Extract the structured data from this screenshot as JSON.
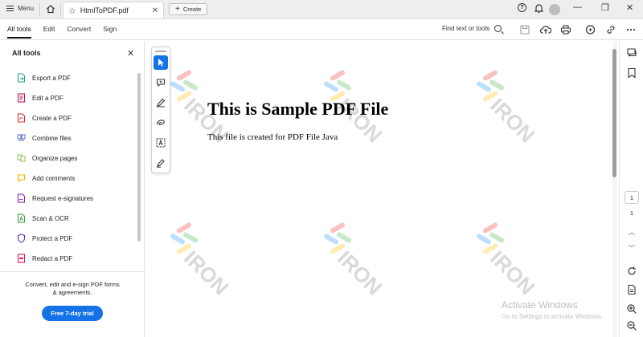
{
  "titlebar": {
    "menu_label": "Menu",
    "tab_title": "HtmlToPDF.pdf",
    "create_label": "Create"
  },
  "toolbar": {
    "tabs": [
      "All tools",
      "Edit",
      "Convert",
      "Sign"
    ],
    "find_label": "Find text or tools"
  },
  "left_panel": {
    "title": "All tools",
    "items": [
      {
        "label": "Export a PDF",
        "icon": "export-pdf-icon",
        "color": "#2f9e8f"
      },
      {
        "label": "Edit a PDF",
        "icon": "edit-pdf-icon",
        "color": "#c2185b"
      },
      {
        "label": "Create a PDF",
        "icon": "create-pdf-icon",
        "color": "#d32f2f"
      },
      {
        "label": "Combine files",
        "icon": "combine-files-icon",
        "color": "#5c6bc0"
      },
      {
        "label": "Organize pages",
        "icon": "organize-pages-icon",
        "color": "#8bc34a"
      },
      {
        "label": "Add comments",
        "icon": "add-comments-icon",
        "color": "#f2b600"
      },
      {
        "label": "Request e-signatures",
        "icon": "request-esign-icon",
        "color": "#8e24aa"
      },
      {
        "label": "Scan & OCR",
        "icon": "scan-ocr-icon",
        "color": "#43a047"
      },
      {
        "label": "Protect a PDF",
        "icon": "protect-pdf-icon",
        "color": "#5e35b1"
      },
      {
        "label": "Redact a PDF",
        "icon": "redact-pdf-icon",
        "color": "#d81b60"
      }
    ],
    "promo_text": "Convert, edit and e-sign PDF forms & agreements.",
    "trial_button": "Free 7-day trial"
  },
  "document": {
    "heading": "This is Sample PDF File",
    "body": "This file is created for PDF File Java",
    "watermark_text": "IRON"
  },
  "windows_notice": {
    "line1": "Activate Windows",
    "line2": "Go to Settings to activate Windows."
  },
  "page_nav": {
    "current_page": "1",
    "total_pages": "1"
  },
  "colors": {
    "accent": "#1473e6"
  }
}
